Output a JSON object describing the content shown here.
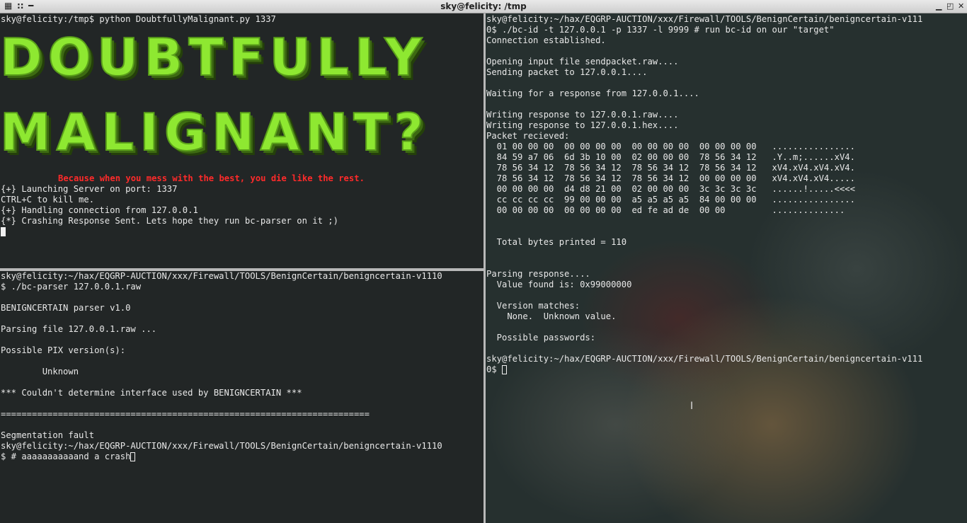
{
  "window": {
    "title": "sky@felicity: /tmp",
    "left_buttons": [
      "▦",
      "::",
      "━"
    ],
    "right_buttons": [
      "▁",
      "◰",
      "✕"
    ]
  },
  "top_left": {
    "prompt_line": "sky@felicity:/tmp$ python DoubtfullyMalignant.py 1337",
    "banner_line1": "DOUBTFULLY",
    "banner_line2": "MALIGNANT?",
    "tagline": "Because when you mess with the best, you die like the rest.",
    "lines": [
      "{+} Launching Server on port: 1337",
      "CTRL+C to kill me.",
      "{+} Handling connection from 127.0.0.1",
      "{*} Crashing Response Sent. Lets hope they run bc-parser on it ;)"
    ]
  },
  "bottom_left": {
    "lines": [
      "sky@felicity:~/hax/EQGRP-AUCTION/xxx/Firewall/TOOLS/BenignCertain/benigncertain-v1110",
      "$ ./bc-parser 127.0.0.1.raw",
      "",
      "BENIGNCERTAIN parser v1.0",
      "",
      "Parsing file 127.0.0.1.raw ...",
      "",
      "Possible PIX version(s):",
      "",
      "        Unknown",
      "",
      "*** Couldn't determine interface used by BENIGNCERTAIN ***",
      "",
      "=======================================================================",
      "",
      "Segmentation fault",
      "sky@felicity:~/hax/EQGRP-AUCTION/xxx/Firewall/TOOLS/BenignCertain/benigncertain-v1110"
    ],
    "last_prompt": "$ # aaaaaaaaaaand a crash"
  },
  "right": {
    "lines": [
      "sky@felicity:~/hax/EQGRP-AUCTION/xxx/Firewall/TOOLS/BenignCertain/benigncertain-v111",
      "0$ ./bc-id -t 127.0.0.1 -p 1337 -l 9999 # run bc-id on our \"target\"",
      "Connection established.",
      "",
      "Opening input file sendpacket.raw....",
      "Sending packet to 127.0.0.1....",
      "",
      "Waiting for a response from 127.0.0.1....",
      "",
      "Writing response to 127.0.0.1.raw....",
      "Writing response to 127.0.0.1.hex....",
      "Packet recieved:",
      "  01 00 00 00  00 00 00 00  00 00 00 00  00 00 00 00   ................",
      "  84 59 a7 06  6d 3b 10 00  02 00 00 00  78 56 34 12   .Y..m;......xV4.",
      "  78 56 34 12  78 56 34 12  78 56 34 12  78 56 34 12   xV4.xV4.xV4.xV4.",
      "  78 56 34 12  78 56 34 12  78 56 34 12  00 00 00 00   xV4.xV4.xV4.....",
      "  00 00 00 00  d4 d8 21 00  02 00 00 00  3c 3c 3c 3c   ......!.....<<<<",
      "  cc cc cc cc  99 00 00 00  a5 a5 a5 a5  84 00 00 00   ................",
      "  00 00 00 00  00 00 00 00  ed fe ad de  00 00         ..............",
      "",
      "",
      "  Total bytes printed = 110",
      "",
      "",
      "Parsing response....",
      "  Value found is: 0x99000000",
      "",
      "  Version matches:",
      "    None.  Unknown value.",
      "",
      "  Possible passwords:",
      "",
      "sky@felicity:~/hax/EQGRP-AUCTION/xxx/Firewall/TOOLS/BenignCertain/benigncertain-v111"
    ],
    "last_prompt": "0$ "
  }
}
